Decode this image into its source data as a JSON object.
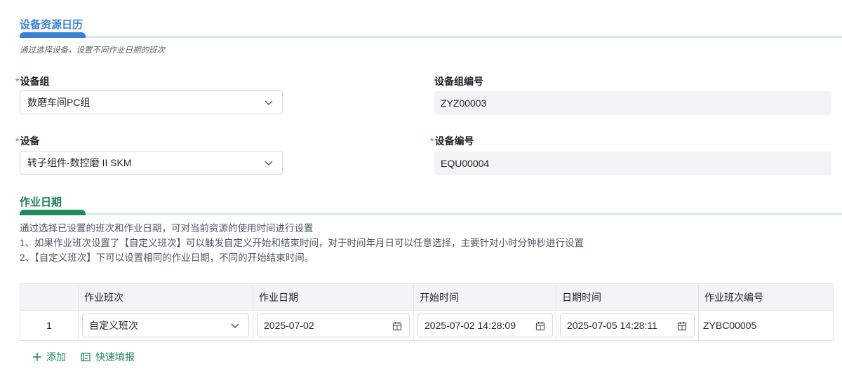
{
  "section1": {
    "title": "设备资源日历",
    "description": "通过选择设备，设置不同作业日期的班次"
  },
  "form": {
    "equipment_group": {
      "label": "设备组",
      "required": true,
      "value": "数磨车间PC组"
    },
    "equipment_group_code": {
      "label": "设备组编号",
      "required": false,
      "value": "ZYZ00003"
    },
    "equipment": {
      "label": "设备",
      "required": true,
      "value": "转子组件-数控磨 II SKM"
    },
    "equipment_code": {
      "label": "设备编号",
      "required": true,
      "value": "EQU00004"
    },
    "required_mark": "*"
  },
  "section2": {
    "title": "作业日期",
    "description_lines": [
      "通过选择已设置的班次和作业日期，可对当前资源的使用时间进行设置",
      "1、如果作业班次设置了【自定义班次】可以触发自定义开始和结束时间，对于时间年月日可以任意选择，主要针对小时分钟秒进行设置",
      "2、【自定义班次】下可以设置相同的作业日期，不同的开始结束时间。"
    ]
  },
  "table": {
    "columns": [
      "作业班次",
      "作业日期",
      "开始时间",
      "日期时间",
      "作业班次编号"
    ],
    "rows": [
      {
        "index": "1",
        "shift": "自定义班次",
        "work_date": "2025-07-02",
        "start_time": "2025-07-02 14:28:09",
        "end_time": "2025-07-05 14:28:11",
        "shift_code": "ZYBC00005"
      }
    ]
  },
  "actions": {
    "add_label": "添加",
    "quick_fill_label": "快速填报",
    "add_icon": "plus-icon",
    "quick_fill_icon": "quick-fill-icon"
  },
  "colors": {
    "section1_accent": "#3a7fd4",
    "section2_accent": "#1f8a5c",
    "required": "#e5484d"
  }
}
